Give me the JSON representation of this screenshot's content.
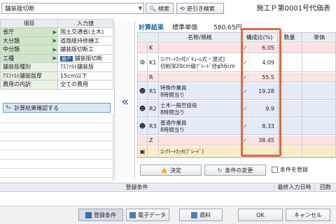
{
  "toolbar": {
    "combo_value": "舗装版切断",
    "search_label": "検索",
    "reverse_label": "逆引き検索",
    "header_title": "施工Ｐ第0001号代価表"
  },
  "left_table": {
    "col_item": "項目",
    "col_value": "入力値",
    "rows": [
      {
        "label": "省庁",
        "value": "国土交通省(土木)"
      },
      {
        "label": "大分類",
        "value": "道路維持修繕工"
      },
      {
        "label": "中分類",
        "value": "舗装版切断工"
      },
      {
        "label": "工種",
        "badge": "施Ｐ",
        "value": "舗装版切断"
      },
      {
        "label": "舗装版種別",
        "value": "ｱｽﾌｧﾙﾄ舗装版"
      },
      {
        "label": "ｱｽﾌｧﾙﾄ舗装版厚",
        "value": "15cm以下"
      },
      {
        "label": "費用の内訳",
        "value": "全ての費用"
      }
    ],
    "confirm_label": "計算結果確認する"
  },
  "result": {
    "calc_label": "計算結果",
    "std_price_label": "標準単価",
    "std_price_value": "580.65円",
    "col_name": "名称/規格",
    "col_ratio": "構成比(%)",
    "col_qty": "数量",
    "col_unit_price": "単価",
    "rows": [
      {
        "code": "K",
        "name1": "",
        "name2": "",
        "ratio": "6.05",
        "checked": true
      },
      {
        "code": "K1",
        "name1": "ｺﾝｸﾘｰﾄｶｯﾀ[ﾊﾞｷｭｰﾑ式・湿式]",
        "name2": "切削深20cm級ﾌﾞﾚｰﾄﾞ径φ56cm",
        "ratio": "4.09",
        "checked": true
      },
      {
        "code": "R",
        "name1": "",
        "name2": "",
        "ratio": "55.5",
        "checked": true
      },
      {
        "code": "R1",
        "name1": "特殊作業員",
        "name2": "8時間当り",
        "ratio": "19.28",
        "checked": true
      },
      {
        "code": "R2",
        "name1": "土木一般世話役",
        "name2": "8時間当り",
        "ratio": "9.9",
        "checked": true
      },
      {
        "code": "R3",
        "name1": "普通作業員",
        "name2": "8時間当り",
        "ratio": "8.33",
        "checked": true
      },
      {
        "code": "Z",
        "name1": "",
        "name2": "",
        "ratio": "38.45",
        "checked": true
      },
      {
        "code": "",
        "name1": "ｺﾝｸﾘｰﾄｶｯﾀ(ﾌﾞﾚｰﾄﾞ)",
        "name2": "",
        "ratio": "",
        "checked": false
      }
    ],
    "decide_label": "決定",
    "change_label": "条件の変更",
    "register_label": "条件を登録"
  },
  "conditions": {
    "col_conditions": "登録条件",
    "col_last_date": "最終入力日時",
    "col_count": "回数"
  },
  "footer": {
    "cond_label": "登録条件",
    "edata_label": "電子データ",
    "docs_label": "資料",
    "ok_label": "OK",
    "cancel_label": "キャンセル"
  },
  "colors": {
    "accent": "#2c5d94",
    "highlight_frame": "#e0693a",
    "check": "#2f73c4"
  }
}
